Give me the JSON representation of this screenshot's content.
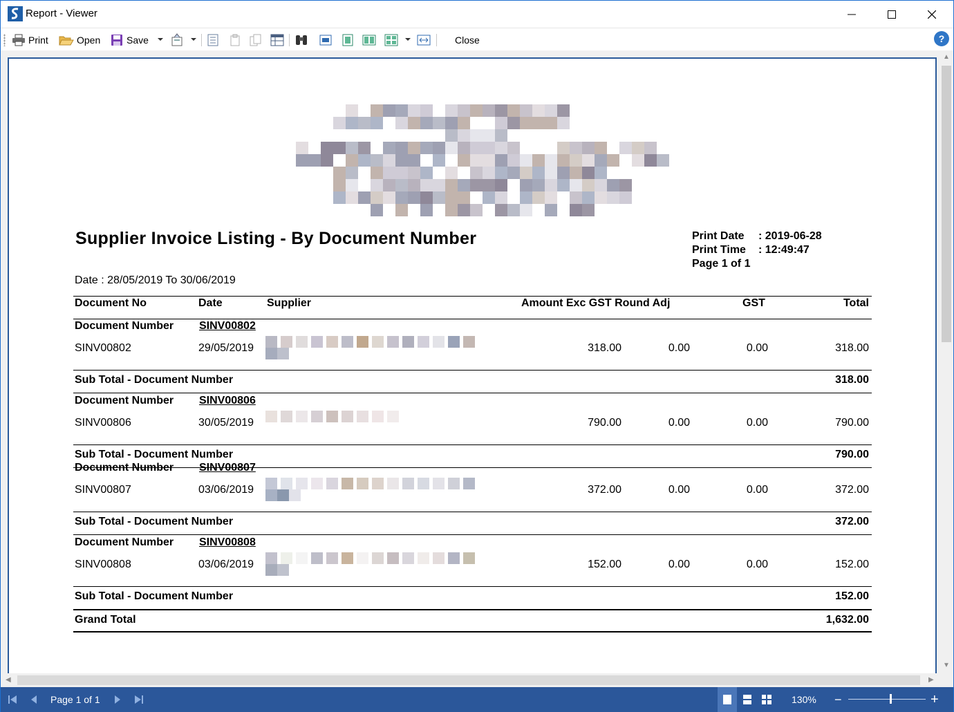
{
  "window": {
    "title": "Report - Viewer",
    "help_glyph": "?"
  },
  "toolbar": {
    "print_label": "Print",
    "open_label": "Open",
    "save_label": "Save",
    "close_label": "Close"
  },
  "report": {
    "title": "Supplier Invoice Listing - By Document Number",
    "print_date_label": "Print Date",
    "print_date_value": ": 2019-06-28",
    "print_time_label": "Print Time",
    "print_time_value": ": 12:49:47",
    "page_label": "Page 1 of 1",
    "date_range": "Date : 28/05/2019 To 30/06/2019",
    "headers": {
      "document_no": "Document No",
      "date": "Date",
      "supplier": "Supplier",
      "amount_round": "Amount Exc GST Round Adj",
      "gst": "GST",
      "total": "Total"
    },
    "group_label": "Document Number",
    "subtotal_label": "Sub Total - Document Number",
    "groups": [
      {
        "key": "SINV00802",
        "doc_no": "SINV00802",
        "date": "29/05/2019",
        "amount": "318.00",
        "round_adj": "0.00",
        "gst": "0.00",
        "total": "318.00",
        "subtotal": "318.00"
      },
      {
        "key": "SINV00806",
        "doc_no": "SINV00806",
        "date": "30/05/2019",
        "amount": "790.00",
        "round_adj": "0.00",
        "gst": "0.00",
        "total": "790.00",
        "subtotal": "790.00"
      },
      {
        "key": "SINV00807",
        "doc_no": "SINV00807",
        "date": "03/06/2019",
        "amount": "372.00",
        "round_adj": "0.00",
        "gst": "0.00",
        "total": "372.00",
        "subtotal": "372.00"
      },
      {
        "key": "SINV00808",
        "doc_no": "SINV00808",
        "date": "03/06/2019",
        "amount": "152.00",
        "round_adj": "0.00",
        "gst": "0.00",
        "total": "152.00",
        "subtotal": "152.00"
      }
    ],
    "grand_total_label": "Grand Total",
    "grand_total_value": "1,632.00"
  },
  "statusbar": {
    "page_text": "Page 1 of 1",
    "zoom": "130%",
    "zoom_minus": "−",
    "zoom_plus": "+",
    "zoom_level_fraction": 0.55
  },
  "colors": {
    "accent": "#2b579a",
    "title_blue": "#1e6fd0"
  }
}
